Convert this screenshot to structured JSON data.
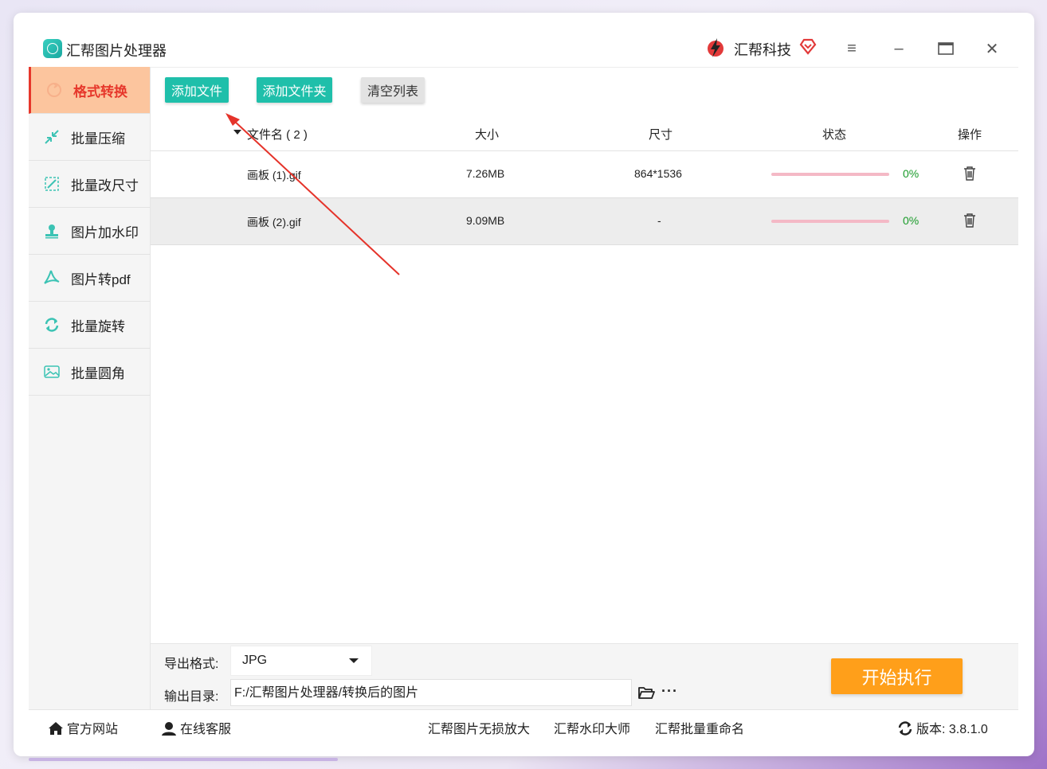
{
  "app": {
    "title": "汇帮图片处理器"
  },
  "brand": {
    "name": "汇帮科技"
  },
  "sidebar": {
    "items": [
      {
        "label": "格式转换",
        "icon": "convert-icon"
      },
      {
        "label": "批量压缩",
        "icon": "compress-icon"
      },
      {
        "label": "批量改尺寸",
        "icon": "resize-icon"
      },
      {
        "label": "图片加水印",
        "icon": "stamp-icon"
      },
      {
        "label": "图片转pdf",
        "icon": "pdf-icon"
      },
      {
        "label": "批量旋转",
        "icon": "rotate-icon"
      },
      {
        "label": "批量圆角",
        "icon": "image-icon"
      }
    ]
  },
  "toolbar": {
    "add_file": "添加文件",
    "add_folder": "添加文件夹",
    "clear_list": "清空列表"
  },
  "table": {
    "headers": {
      "name": "文件名 ( 2 )",
      "size": "大小",
      "dimensions": "尺寸",
      "status": "状态",
      "actions": "操作"
    },
    "rows": [
      {
        "name": "画板 (1).gif",
        "size": "7.26MB",
        "dimensions": "864*1536",
        "progress": 0,
        "percent": "0%"
      },
      {
        "name": "画板 (2).gif",
        "size": "9.09MB",
        "dimensions": "-",
        "progress": 0,
        "percent": "0%"
      }
    ]
  },
  "export": {
    "format_label": "导出格式:",
    "format_value": "JPG",
    "dir_label": "输出目录:",
    "dir_value": "F:/汇帮图片处理器/转换后的图片",
    "more": "···",
    "start": "开始执行"
  },
  "footer": {
    "website": "官方网站",
    "support": "在线客服",
    "link1": "汇帮图片无损放大",
    "link2": "汇帮水印大师",
    "link3": "汇帮批量重命名",
    "version": "版本: 3.8.1.0"
  },
  "colors": {
    "accent_teal": "#1fbfaa",
    "active_bg": "#fcc59e",
    "active_text": "#e6372b",
    "start_orange": "#ff9f1a",
    "progress_pink": "#f4b9c6",
    "percent_green": "#1a9b2a"
  }
}
